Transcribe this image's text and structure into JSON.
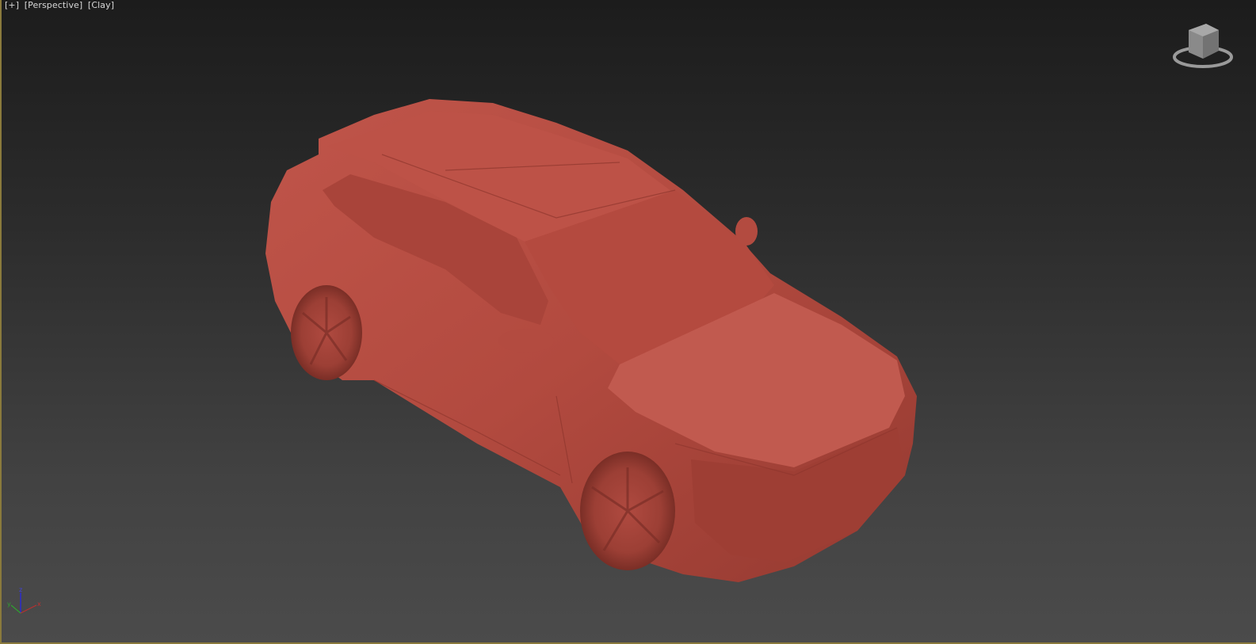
{
  "viewport": {
    "labels": [
      "[+]",
      "[Perspective]",
      "[Clay]"
    ],
    "active_border_color": "#8a7a3c",
    "model_color": "#b5493e"
  },
  "viewcube": {
    "icon": "viewcube-icon"
  },
  "axis_gizmo": {
    "x": "x",
    "y": "y",
    "z": "z"
  }
}
